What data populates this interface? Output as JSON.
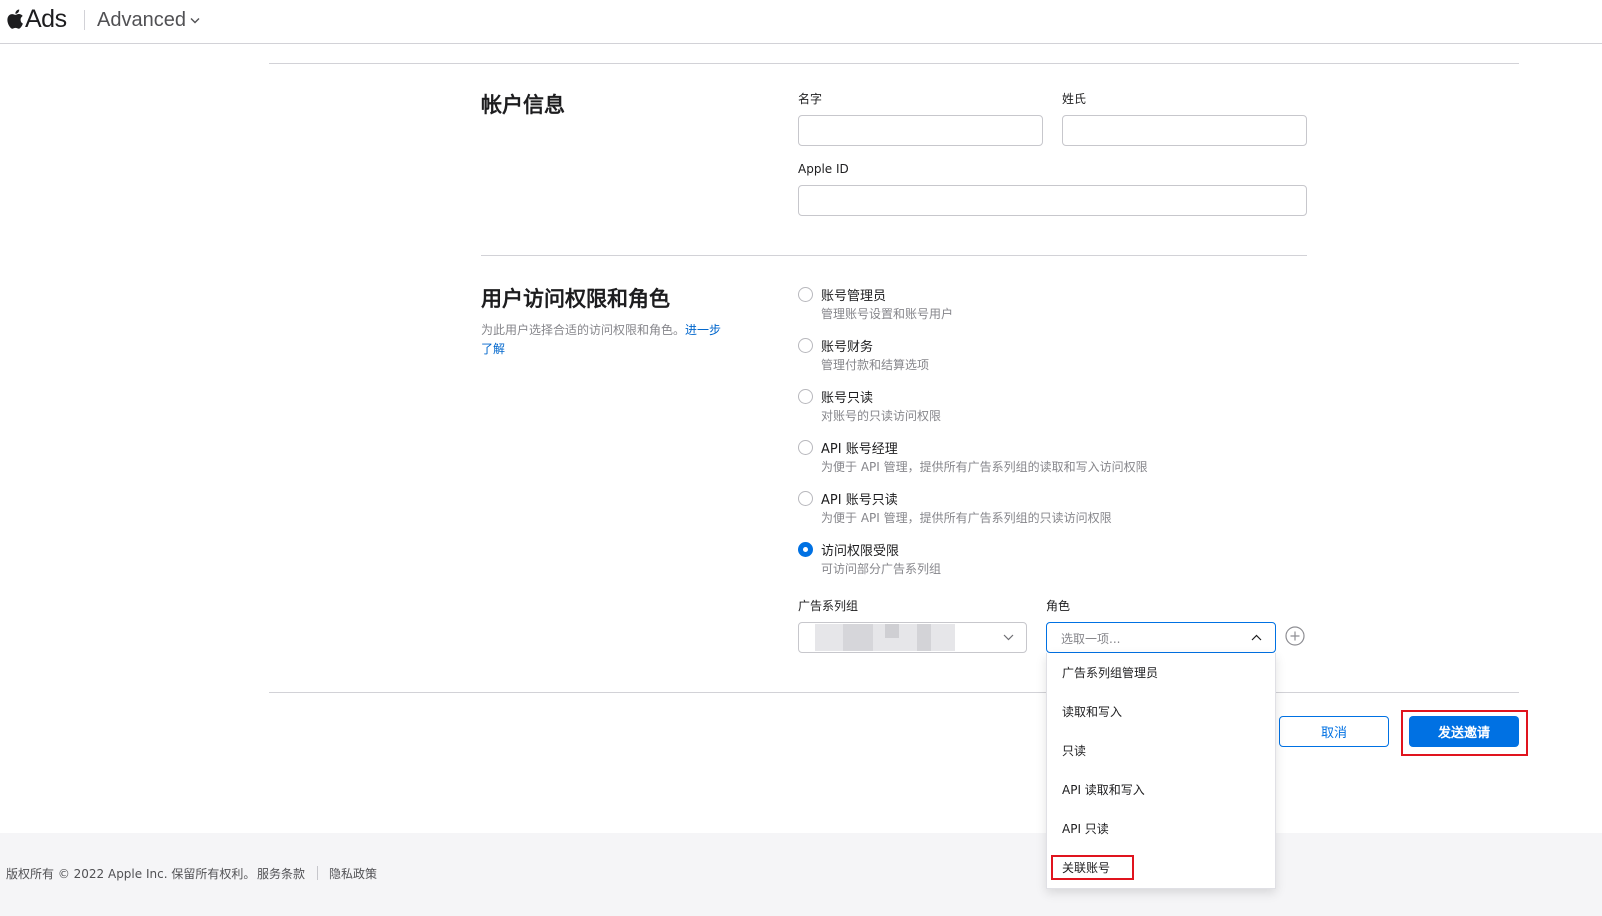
{
  "header": {
    "brand": "Ads",
    "product": "Advanced"
  },
  "account_info": {
    "title": "帐户信息",
    "first_name_label": "名字",
    "first_name_value": "",
    "last_name_label": "姓氏",
    "last_name_value": "",
    "apple_id_label": "Apple ID",
    "apple_id_value": ""
  },
  "access": {
    "title": "用户访问权限和角色",
    "description": "为此用户选择合适的访问权限和角色。",
    "learn_more_a": "进一步",
    "learn_more_b": "了解",
    "roles": [
      {
        "title": "账号管理员",
        "desc": "管理账号设置和账号用户",
        "selected": false
      },
      {
        "title": "账号财务",
        "desc": "管理付款和结算选项",
        "selected": false
      },
      {
        "title": "账号只读",
        "desc": "对账号的只读访问权限",
        "selected": false
      },
      {
        "title": "API 账号经理",
        "desc": "为便于 API 管理，提供所有广告系列组的读取和写入访问权限",
        "selected": false
      },
      {
        "title": "API 账号只读",
        "desc": "为便于 API 管理，提供所有广告系列组的只读访问权限",
        "selected": false
      },
      {
        "title": "访问权限受限",
        "desc": "可访问部分广告系列组",
        "selected": true
      }
    ],
    "campaign_group_label": "广告系列组",
    "role_label": "角色",
    "role_placeholder": "选取一项...",
    "role_options": [
      "广告系列组管理员",
      "读取和写入",
      "只读",
      "API 读取和写入",
      "API 只读",
      "关联账号"
    ]
  },
  "actions": {
    "cancel": "取消",
    "send": "发送邀请"
  },
  "footer": {
    "copyright": "版权所有 © 2022 Apple Inc. 保留所有权利。",
    "terms": "服务条款",
    "privacy": "隐私政策"
  },
  "colors": {
    "accent": "#0071e3",
    "highlight": "#e0141e"
  }
}
